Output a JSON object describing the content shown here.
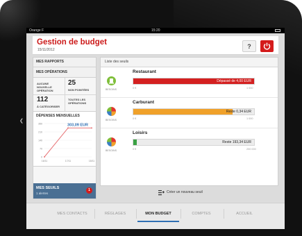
{
  "status_bar": {
    "carrier": "Orange F",
    "time": "15:20"
  },
  "app": {
    "title": "Gestion de budget",
    "date": "15/11/2012",
    "help_label": "?"
  },
  "left_panel": {
    "rapports_label": "MES RAPPORTS",
    "operations_label": "MES OPÉRATIONS",
    "op_cells": [
      {
        "value": "",
        "label": "AUCUNE NOUVELLE OPÉRATION"
      },
      {
        "value": "25",
        "label": "NON POINTÉES"
      },
      {
        "value": "112",
        "label": "À CATÉGORISER"
      },
      {
        "value": "",
        "label": "TOUTES LES OPÉRATIONS"
      }
    ],
    "chart_title": "DÉPENSES MENSUELLES",
    "seuils": {
      "title": "MES SEUILS",
      "subtitle": "1 alertes",
      "badge": "1"
    }
  },
  "chart_data": {
    "type": "line",
    "title": "DÉPENSES MENSUELLES",
    "x": [
      "16/11",
      "17/11",
      "18/11"
    ],
    "y": [
      0,
      303.09,
      303.09
    ],
    "annotation": "303,09 EUR",
    "yticks": [
      "350",
      "210",
      "140",
      "70",
      "0"
    ],
    "ylim": [
      0,
      350
    ],
    "color": "#e8777a"
  },
  "right_panel": {
    "header": "Liste des seuils",
    "items": [
      {
        "name": "Restaurant",
        "icon": "restaurant-icon",
        "icon_label": "BESOINS",
        "bar_text": "Dépassé de 4,00 EUR",
        "fill_pct": 100,
        "color": "#d42020",
        "text_color": "#ffffff",
        "min": "0 €",
        "max": "1 000"
      },
      {
        "name": "Carburant",
        "icon": "pie-chart-icon",
        "icon_label": "BESOINS",
        "bar_text": "Reste 0,34 EUR",
        "fill_pct": 82,
        "color": "#f0a12a",
        "text_color": "#222222",
        "min": "0 €",
        "max": "1 000"
      },
      {
        "name": "Loisirs",
        "icon": "pie-chart-icon",
        "icon_label": "BESOINS",
        "bar_text": "Reste 193,34 EUR",
        "fill_pct": 3,
        "color": "#3aa143",
        "text_color": "#222222",
        "min": "0 €",
        "max": "200 000"
      }
    ],
    "create_label": "Créer un nouveau seuil"
  },
  "tabs": [
    {
      "label": "MES CONTACTS",
      "active": false
    },
    {
      "label": "RÉGLAGES",
      "active": false
    },
    {
      "label": "MON BUDGET",
      "active": true
    },
    {
      "label": "COMPTES",
      "active": false
    },
    {
      "label": "ACCUEIL",
      "active": false
    }
  ]
}
